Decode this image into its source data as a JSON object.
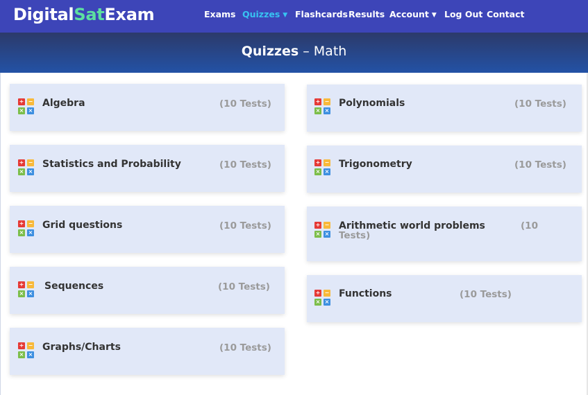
{
  "logo": {
    "part1": "Digital",
    "part2": "Sat",
    "part3": "Exam"
  },
  "nav": [
    {
      "label": "Exams",
      "active": false,
      "dropdown": false
    },
    {
      "label": "Quizzes",
      "active": true,
      "dropdown": true
    },
    {
      "label": "Flashcards",
      "active": false,
      "dropdown": false
    },
    {
      "label": "Results",
      "active": false,
      "dropdown": false
    },
    {
      "label": "Account",
      "active": false,
      "dropdown": true
    },
    {
      "label": "Log Out",
      "active": false,
      "dropdown": false
    },
    {
      "label": "Contact",
      "active": false,
      "dropdown": false
    }
  ],
  "banner": {
    "strong": "Quizzes",
    "rest": " – Math"
  },
  "icon_glyphs": {
    "red": "+",
    "yellow": "−",
    "green": "×",
    "blue": "×"
  },
  "quizzes": [
    {
      "title": "Algebra",
      "count": "(10 Tests)"
    },
    {
      "title": "Polynomials",
      "count": "(10 Tests)"
    },
    {
      "title": "Statistics and Probability",
      "count": "(10 Tests)"
    },
    {
      "title": "Trigonometry",
      "count": "(10 Tests)"
    },
    {
      "title": "Grid questions",
      "count": "(10 Tests)"
    },
    {
      "title": "Arithmetic world problems",
      "count": "(10 Tests)"
    },
    {
      "title": "Sequences",
      "count": "(10 Tests)"
    },
    {
      "title": "Functions",
      "count": "(10 Tests)"
    },
    {
      "title": "Graphs/Charts",
      "count": "(10 Tests)"
    }
  ],
  "colors": {
    "navbar": "#3d45b8",
    "accent_active": "#37c3f2",
    "logo_accent": "#5de0a0",
    "card_bg": "#e1e8f8"
  }
}
